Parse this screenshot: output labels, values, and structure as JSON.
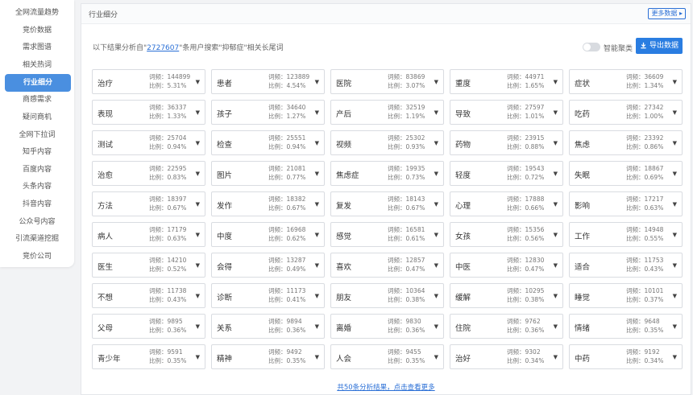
{
  "sidebar": {
    "items": [
      {
        "label": "全网流量趋势",
        "active": false
      },
      {
        "label": "竞价数据",
        "active": false
      },
      {
        "label": "需求图谱",
        "active": false
      },
      {
        "label": "相关热词",
        "active": false
      },
      {
        "label": "行业细分",
        "active": true
      },
      {
        "label": "商感需求",
        "active": false
      },
      {
        "label": "疑问商机",
        "active": false
      },
      {
        "label": "全网下拉词",
        "active": false
      },
      {
        "label": "知乎内容",
        "active": false
      },
      {
        "label": "百度内容",
        "active": false
      },
      {
        "label": "头条内容",
        "active": false
      },
      {
        "label": "抖音内容",
        "active": false
      },
      {
        "label": "公众号内容",
        "active": false
      },
      {
        "label": "引流渠道挖掘",
        "active": false
      },
      {
        "label": "竞价公司",
        "active": false
      }
    ]
  },
  "header": {
    "title": "行业细分",
    "more_label": "更多数据 ▸"
  },
  "info": {
    "prefix": "以下结果分析自\"",
    "count": "2727607",
    "suffix": "\"条用户搜索\"抑郁症\"相关长尾词"
  },
  "controls": {
    "toggle_label": "智能聚类",
    "export_label": "导出数据"
  },
  "stat_labels": {
    "count_prefix": "词频：",
    "ratio_prefix": "比例："
  },
  "icons": {
    "arrow": "caret-down-icon",
    "export": "download-icon",
    "more": "chevron-right-icon"
  },
  "colors": {
    "accent": "#2a7de1",
    "active_nav": "#4a8fe0"
  },
  "items": [
    {
      "kw": "治疗",
      "count": "144899",
      "ratio": "5.31%"
    },
    {
      "kw": "患者",
      "count": "123889",
      "ratio": "4.54%"
    },
    {
      "kw": "医院",
      "count": "83869",
      "ratio": "3.07%"
    },
    {
      "kw": "重度",
      "count": "44971",
      "ratio": "1.65%"
    },
    {
      "kw": "症状",
      "count": "36609",
      "ratio": "1.34%"
    },
    {
      "kw": "表现",
      "count": "36337",
      "ratio": "1.33%"
    },
    {
      "kw": "孩子",
      "count": "34640",
      "ratio": "1.27%"
    },
    {
      "kw": "产后",
      "count": "32519",
      "ratio": "1.19%"
    },
    {
      "kw": "导致",
      "count": "27597",
      "ratio": "1.01%"
    },
    {
      "kw": "吃药",
      "count": "27342",
      "ratio": "1.00%"
    },
    {
      "kw": "测试",
      "count": "25704",
      "ratio": "0.94%"
    },
    {
      "kw": "检查",
      "count": "25551",
      "ratio": "0.94%"
    },
    {
      "kw": "视频",
      "count": "25302",
      "ratio": "0.93%"
    },
    {
      "kw": "药物",
      "count": "23915",
      "ratio": "0.88%"
    },
    {
      "kw": "焦虑",
      "count": "23392",
      "ratio": "0.86%"
    },
    {
      "kw": "治愈",
      "count": "22595",
      "ratio": "0.83%"
    },
    {
      "kw": "图片",
      "count": "21081",
      "ratio": "0.77%"
    },
    {
      "kw": "焦虑症",
      "count": "19935",
      "ratio": "0.73%"
    },
    {
      "kw": "轻度",
      "count": "19543",
      "ratio": "0.72%"
    },
    {
      "kw": "失眠",
      "count": "18867",
      "ratio": "0.69%"
    },
    {
      "kw": "方法",
      "count": "18397",
      "ratio": "0.67%"
    },
    {
      "kw": "发作",
      "count": "18382",
      "ratio": "0.67%"
    },
    {
      "kw": "复发",
      "count": "18143",
      "ratio": "0.67%"
    },
    {
      "kw": "心理",
      "count": "17888",
      "ratio": "0.66%"
    },
    {
      "kw": "影响",
      "count": "17217",
      "ratio": "0.63%"
    },
    {
      "kw": "病人",
      "count": "17179",
      "ratio": "0.63%"
    },
    {
      "kw": "中度",
      "count": "16968",
      "ratio": "0.62%"
    },
    {
      "kw": "感觉",
      "count": "16581",
      "ratio": "0.61%"
    },
    {
      "kw": "女孩",
      "count": "15356",
      "ratio": "0.56%"
    },
    {
      "kw": "工作",
      "count": "14948",
      "ratio": "0.55%"
    },
    {
      "kw": "医生",
      "count": "14210",
      "ratio": "0.52%"
    },
    {
      "kw": "会得",
      "count": "13287",
      "ratio": "0.49%"
    },
    {
      "kw": "喜欢",
      "count": "12857",
      "ratio": "0.47%"
    },
    {
      "kw": "中医",
      "count": "12830",
      "ratio": "0.47%"
    },
    {
      "kw": "适合",
      "count": "11753",
      "ratio": "0.43%"
    },
    {
      "kw": "不想",
      "count": "11738",
      "ratio": "0.43%"
    },
    {
      "kw": "诊断",
      "count": "11173",
      "ratio": "0.41%"
    },
    {
      "kw": "朋友",
      "count": "10364",
      "ratio": "0.38%"
    },
    {
      "kw": "缓解",
      "count": "10295",
      "ratio": "0.38%"
    },
    {
      "kw": "睡觉",
      "count": "10101",
      "ratio": "0.37%"
    },
    {
      "kw": "父母",
      "count": "9895",
      "ratio": "0.36%"
    },
    {
      "kw": "关系",
      "count": "9894",
      "ratio": "0.36%"
    },
    {
      "kw": "离婚",
      "count": "9830",
      "ratio": "0.36%"
    },
    {
      "kw": "住院",
      "count": "9762",
      "ratio": "0.36%"
    },
    {
      "kw": "情绪",
      "count": "9648",
      "ratio": "0.35%"
    },
    {
      "kw": "青少年",
      "count": "9591",
      "ratio": "0.35%"
    },
    {
      "kw": "精神",
      "count": "9492",
      "ratio": "0.35%"
    },
    {
      "kw": "人会",
      "count": "9455",
      "ratio": "0.35%"
    },
    {
      "kw": "治好",
      "count": "9302",
      "ratio": "0.34%"
    },
    {
      "kw": "中药",
      "count": "9192",
      "ratio": "0.34%"
    }
  ],
  "footer": {
    "text": "共50条分析结果，点击查看更多"
  }
}
